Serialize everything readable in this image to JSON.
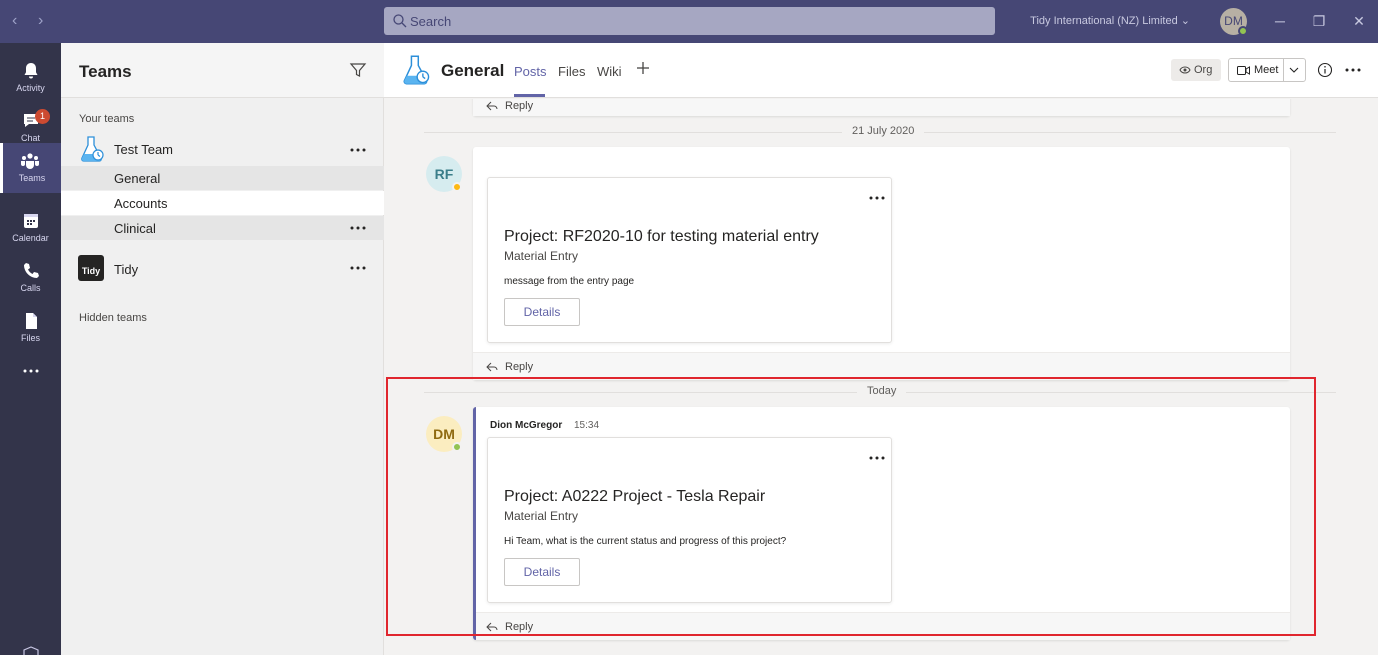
{
  "titlebar": {
    "search_placeholder": "Search",
    "org_name": "Tidy International (NZ) Limited",
    "user_initials": "DM"
  },
  "rail": {
    "items": [
      {
        "label": "Activity",
        "icon": "bell-icon"
      },
      {
        "label": "Chat",
        "icon": "chat-icon",
        "badge": "1"
      },
      {
        "label": "Teams",
        "icon": "teams-icon",
        "active": true
      },
      {
        "label": "Calendar",
        "icon": "calendar-icon"
      },
      {
        "label": "Calls",
        "icon": "phone-icon"
      },
      {
        "label": "Files",
        "icon": "file-icon"
      }
    ]
  },
  "teams_panel": {
    "title": "Teams",
    "section_label": "Your teams",
    "teams": [
      {
        "name": "Test Team",
        "channels": [
          "General",
          "Accounts",
          "Clinical"
        ]
      },
      {
        "name": "Tidy",
        "logo_text": "Tidy",
        "channels": []
      }
    ],
    "hidden_label": "Hidden teams"
  },
  "channel_header": {
    "name": "General",
    "tabs": [
      "Posts",
      "Files",
      "Wiki"
    ],
    "org_label": "Org",
    "meet_label": "Meet"
  },
  "conversation": {
    "reply_label": "Reply",
    "date_separators": [
      "21 July 2020",
      "Today"
    ],
    "posts": [
      {
        "avatar_initials": "RF",
        "card": {
          "title": "Project: RF2020-10 for testing material entry",
          "subtitle": "Material Entry",
          "body": "message from the entry page",
          "button": "Details"
        }
      },
      {
        "avatar_initials": "DM",
        "author": "Dion McGregor",
        "time": "15:34",
        "card": {
          "title": "Project: A0222 Project - Tesla Repair",
          "subtitle": "Material Entry",
          "body": "Hi Team, what is the current status and progress of this project?",
          "button": "Details"
        }
      }
    ]
  },
  "colors": {
    "titlebar": "#464775",
    "rail": "#33344a",
    "accent": "#6264a7",
    "highlight": "#e0262e",
    "presence_available": "#92c353",
    "presence_away": "#fdb913"
  }
}
